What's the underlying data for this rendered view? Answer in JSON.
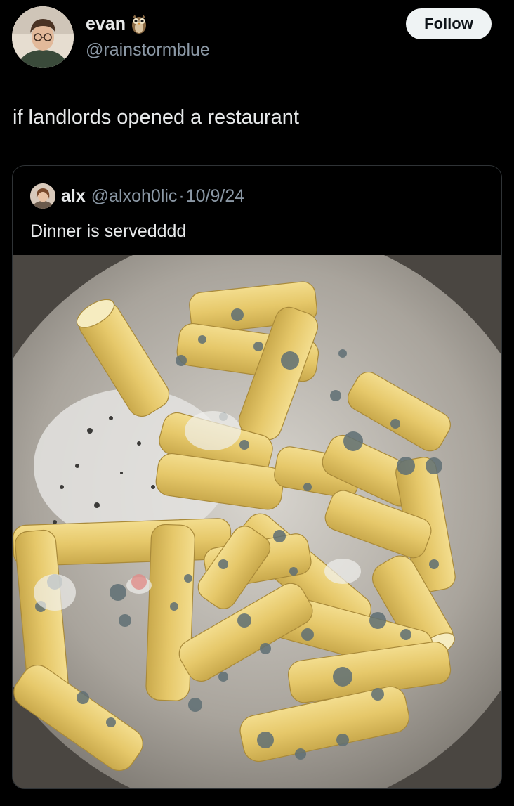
{
  "author": {
    "display_name": "evan",
    "badge_icon": "owl-icon",
    "handle": "@rainstormblue"
  },
  "follow_label": "Follow",
  "tweet_text": "if landlords opened a restaurant",
  "quote": {
    "display_name": "alx",
    "handle": "@alxoh0lic",
    "separator": "·",
    "date": "10/9/24",
    "text": "Dinner is servedddd",
    "media_description": "photo-moldy-rigatoni-in-pot"
  },
  "colors": {
    "background": "#000000",
    "text_primary": "#e7e9ea",
    "text_secondary": "#8b98a5",
    "follow_bg": "#eff3f4",
    "border": "#2f3336"
  }
}
